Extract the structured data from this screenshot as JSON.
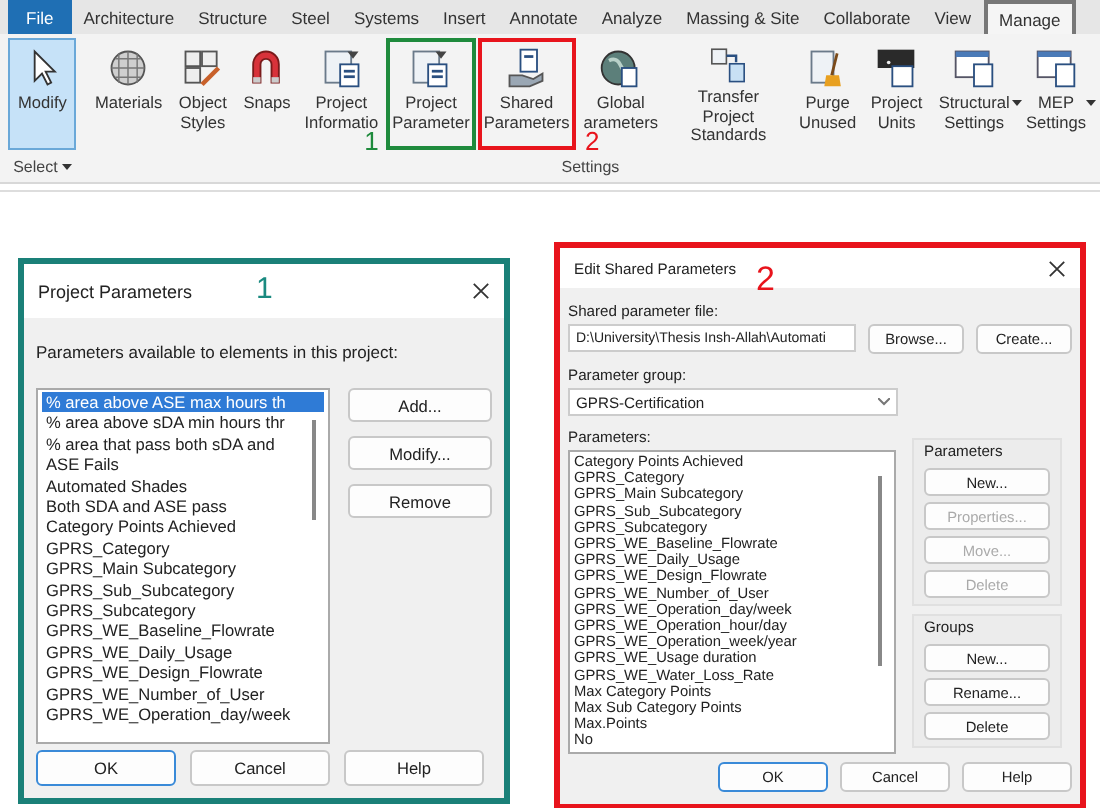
{
  "ribbon": {
    "tabs": [
      {
        "label": "File",
        "kind": "file",
        "selected": false
      },
      {
        "label": "Architecture",
        "kind": "tab",
        "selected": false
      },
      {
        "label": "Structure",
        "kind": "tab",
        "selected": false
      },
      {
        "label": "Steel",
        "kind": "tab",
        "selected": false
      },
      {
        "label": "Systems",
        "kind": "tab",
        "selected": false
      },
      {
        "label": "Insert",
        "kind": "tab",
        "selected": false
      },
      {
        "label": "Annotate",
        "kind": "tab",
        "selected": false
      },
      {
        "label": "Analyze",
        "kind": "tab",
        "selected": false
      },
      {
        "label": "Massing & Site",
        "kind": "tab",
        "selected": false
      },
      {
        "label": "Collaborate",
        "kind": "tab",
        "selected": false
      },
      {
        "label": "View",
        "kind": "tab",
        "selected": false
      },
      {
        "label": "Manage",
        "kind": "tab",
        "selected": true
      }
    ],
    "panels": [
      {
        "label": "Select",
        "tools": [
          {
            "label": "Modify",
            "selected": true
          }
        ]
      },
      {
        "label": "Settings",
        "tools": [
          {
            "label": "Materials",
            "selected": false
          },
          {
            "label": "Object\nStyles",
            "selected": false
          },
          {
            "label": "Snaps",
            "selected": false
          },
          {
            "label": "Project\nInformatio",
            "selected": false
          },
          {
            "label": "Project\nParameter",
            "selected": false,
            "callout": {
              "number": "1",
              "color": "#1e8a3c"
            }
          },
          {
            "label": "Shared\nParameters",
            "selected": false,
            "callout": {
              "number": "2",
              "color": "#e8141c"
            }
          },
          {
            "label": "Global\narameters",
            "selected": false
          },
          {
            "label": "Transfer\nProject Standards",
            "selected": false
          },
          {
            "label": "Purge\nUnused",
            "selected": false
          },
          {
            "label": "Project\nUnits",
            "selected": false
          },
          {
            "label": "Structural\nSettings",
            "selected": false,
            "dropdown": true
          },
          {
            "label": "MEP\nSettings",
            "selected": false,
            "dropdown": true
          }
        ]
      }
    ]
  },
  "project_parameters": {
    "title": "Project Parameters",
    "callout": {
      "number": "1",
      "color": "#1a8a80"
    },
    "prompt": "Parameters available to elements in this project:",
    "items": [
      {
        "label": "% area above ASE max hours th",
        "selected": true
      },
      {
        "label": "% area above sDA min hours thr",
        "selected": false
      },
      {
        "label": "% area that pass both sDA and",
        "selected": false
      },
      {
        "label": "ASE Fails",
        "selected": false
      },
      {
        "label": "Automated Shades",
        "selected": false
      },
      {
        "label": "Both SDA and ASE pass",
        "selected": false
      },
      {
        "label": "Category Points Achieved",
        "selected": false
      },
      {
        "label": "GPRS_Category",
        "selected": false
      },
      {
        "label": "GPRS_Main Subcategory",
        "selected": false
      },
      {
        "label": "GPRS_Sub_Subcategory",
        "selected": false
      },
      {
        "label": "GPRS_Subcategory",
        "selected": false
      },
      {
        "label": "GPRS_WE_Baseline_Flowrate",
        "selected": false
      },
      {
        "label": "GPRS_WE_Daily_Usage",
        "selected": false
      },
      {
        "label": "GPRS_WE_Design_Flowrate",
        "selected": false
      },
      {
        "label": "GPRS_WE_Number_of_User",
        "selected": false
      },
      {
        "label": "GPRS_WE_Operation_day/week",
        "selected": false
      }
    ],
    "side_buttons": [
      "Add...",
      "Modify...",
      "Remove"
    ],
    "buttons": [
      {
        "label": "OK",
        "default": true
      },
      {
        "label": "Cancel",
        "default": false
      },
      {
        "label": "Help",
        "default": false
      }
    ]
  },
  "edit_shared_parameters": {
    "title": "Edit Shared Parameters",
    "callout": {
      "number": "2",
      "color": "#e8141c"
    },
    "file_label": "Shared parameter file:",
    "file_value": "D:\\University\\Thesis Insh-Allah\\Automati",
    "file_buttons": [
      "Browse...",
      "Create..."
    ],
    "group_label": "Parameter group:",
    "group_value": "GPRS-Certification",
    "list_label": "Parameters:",
    "items": [
      "Category Points Achieved",
      "GPRS_Category",
      "GPRS_Main Subcategory",
      "GPRS_Sub_Subcategory",
      "GPRS_Subcategory",
      "GPRS_WE_Baseline_Flowrate",
      "GPRS_WE_Daily_Usage",
      "GPRS_WE_Design_Flowrate",
      "GPRS_WE_Number_of_User",
      "GPRS_WE_Operation_day/week",
      "GPRS_WE_Operation_hour/day",
      "GPRS_WE_Operation_week/year",
      "GPRS_WE_Usage duration",
      "GPRS_WE_Water_Loss_Rate",
      "Max Category Points",
      "Max Sub Category Points",
      "Max.Points",
      "No"
    ],
    "groups": [
      {
        "title": "Parameters",
        "buttons": [
          {
            "label": "New...",
            "disabled": false
          },
          {
            "label": "Properties...",
            "disabled": true
          },
          {
            "label": "Move...",
            "disabled": true
          },
          {
            "label": "Delete",
            "disabled": true
          }
        ]
      },
      {
        "title": "Groups",
        "buttons": [
          {
            "label": "New...",
            "disabled": false
          },
          {
            "label": "Rename...",
            "disabled": false
          },
          {
            "label": "Delete",
            "disabled": false
          }
        ]
      }
    ],
    "buttons": [
      {
        "label": "OK",
        "default": true
      },
      {
        "label": "Cancel",
        "default": false
      },
      {
        "label": "Help",
        "default": false
      }
    ]
  }
}
